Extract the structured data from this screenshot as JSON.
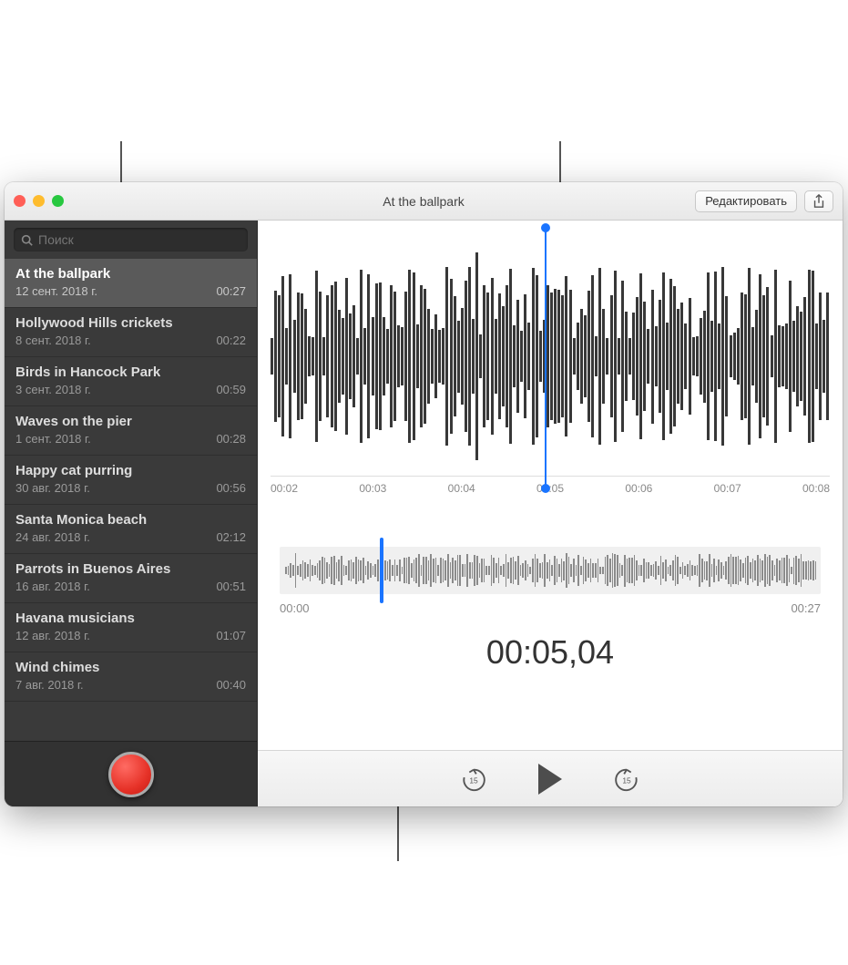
{
  "titlebar": {
    "title": "At the ballpark",
    "edit_label": "Редактировать"
  },
  "search": {
    "placeholder": "Поиск"
  },
  "recordings": [
    {
      "name": "At the ballpark",
      "date": "12 сент. 2018 г.",
      "duration": "00:27",
      "selected": true
    },
    {
      "name": "Hollywood Hills crickets",
      "date": "8 сент. 2018 г.",
      "duration": "00:22",
      "selected": false
    },
    {
      "name": "Birds in Hancock Park",
      "date": "3 сент. 2018 г.",
      "duration": "00:59",
      "selected": false
    },
    {
      "name": "Waves on the pier",
      "date": "1 сент. 2018 г.",
      "duration": "00:28",
      "selected": false
    },
    {
      "name": "Happy cat purring",
      "date": "30 авг. 2018 г.",
      "duration": "00:56",
      "selected": false
    },
    {
      "name": "Santa Monica beach",
      "date": "24 авг. 2018 г.",
      "duration": "02:12",
      "selected": false
    },
    {
      "name": "Parrots in Buenos Aires",
      "date": "16 авг. 2018 г.",
      "duration": "00:51",
      "selected": false
    },
    {
      "name": "Havana musicians",
      "date": "12 авг. 2018 г.",
      "duration": "01:07",
      "selected": false
    },
    {
      "name": "Wind chimes",
      "date": "7 авг. 2018 г.",
      "duration": "00:40",
      "selected": false
    }
  ],
  "timeline_ticks": [
    "00:02",
    "00:03",
    "00:04",
    "00:05",
    "00:06",
    "00:07",
    "00:08"
  ],
  "overview": {
    "start": "00:00",
    "end": "00:27"
  },
  "playback": {
    "current_time": "00:05,04"
  },
  "skip_seconds": "15"
}
